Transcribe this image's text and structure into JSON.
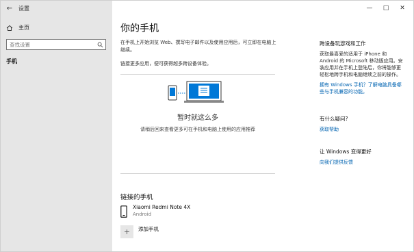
{
  "window": {
    "title": "设置",
    "back_glyph": "←",
    "minimize_glyph": "—",
    "maximize_glyph": "□",
    "close_glyph": "✕"
  },
  "sidebar": {
    "home_label": "主页",
    "search_placeholder": "查找设置",
    "active_item": "手机"
  },
  "main": {
    "title": "你的手机",
    "intro": "在手机上开始浏览 Web、撰写电子邮件以及使用应用后，可立即在电脑上继续。",
    "link_more": "链接更多应用，便可获得越多跨设备体验。",
    "empty_title": "暂时就这么多",
    "empty_desc": "请稍后回来查看更多可在手机和电脑上使用的应用推荐",
    "linked_title": "链接的手机",
    "device": {
      "name": "Xiaomi Redmi Note 4X",
      "os": "Android"
    },
    "add_phone": "添加手机",
    "add_glyph": "+"
  },
  "right": {
    "cross_title": "跨设备玩游戏和工作",
    "cross_text": "获取最喜爱的适用于 iPhone 和 Android 的 Microsoft 移动版应用。安装应用并在手机上登陆后，你将能够更轻松地跨手机和电脑继续之前的操作。",
    "cross_link": "拥有 Windows 手机？了解电脑具备哪些与手机兼容的功能。",
    "question_title": "有什么疑问?",
    "help_link": "获取帮助",
    "improve_title": "让 Windows 变得更好",
    "feedback_link": "向我们提供反馈"
  },
  "colors": {
    "sidebar_bg": "#e6e6e6",
    "link": "#0063b1",
    "accent": "#0078d7"
  }
}
